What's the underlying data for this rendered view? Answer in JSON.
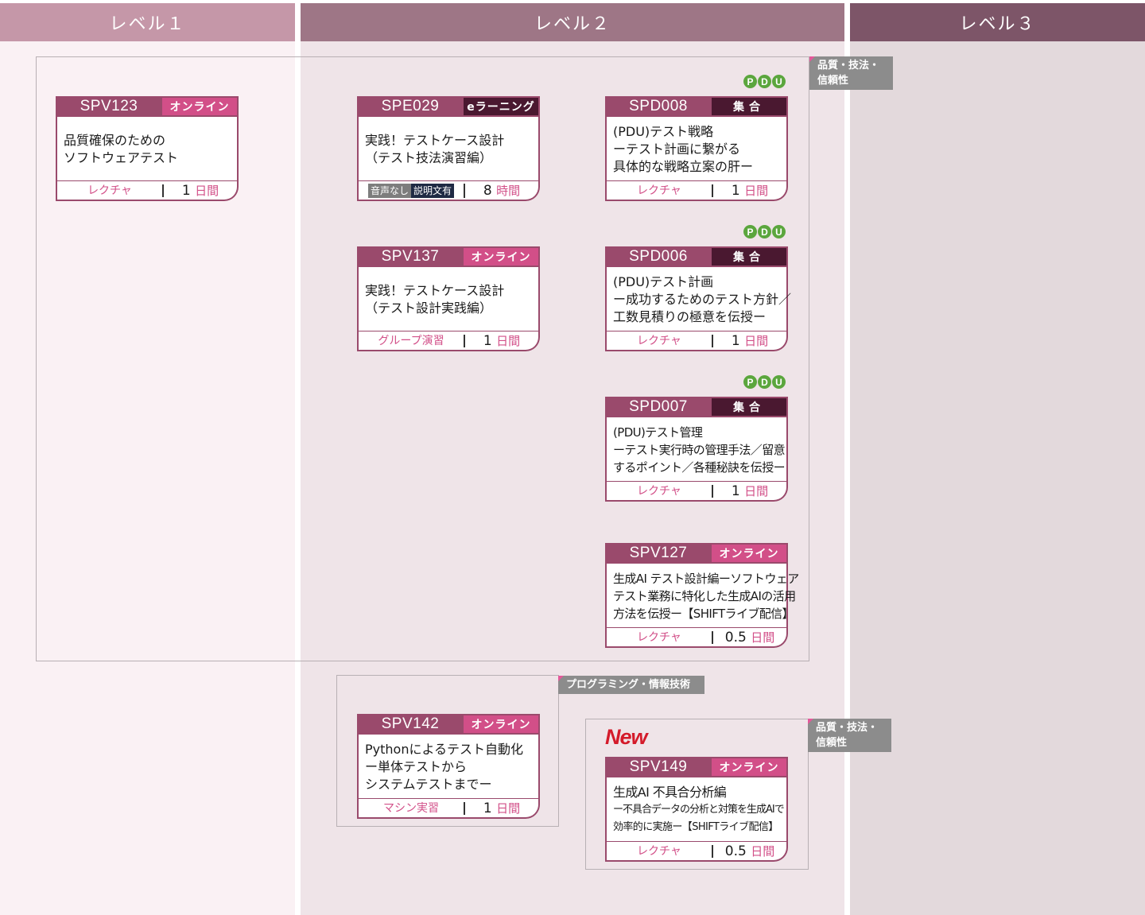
{
  "colors": {
    "level1_header": "#c597a8",
    "level2_header": "#9e7686",
    "level3_header": "#7d5568",
    "level1_bg": "#faf1f4",
    "level2_bg": "#efe4e8",
    "level3_bg": "#e3d9dc",
    "card_accent": "#9a4a6c",
    "online_badge": "#d24f88",
    "shugo_badge": "#4a1830",
    "pdu_green": "#5ba63d",
    "new_red": "#d41a2a",
    "group_tag": "#8c8c8c"
  },
  "levels": [
    {
      "label": "レベル１"
    },
    {
      "label": "レベル２"
    },
    {
      "label": "レベル３"
    }
  ],
  "groups": {
    "quality1": {
      "tag_line1": "品質・技法・",
      "tag_line2": "信頼性"
    },
    "programming": {
      "tag": "プログラミング・情報技術"
    },
    "quality2": {
      "tag_line1": "品質・技法・",
      "tag_line2": "信頼性"
    }
  },
  "pdu_icon": {
    "p": "P",
    "d": "D",
    "u": "U",
    "icon": "pdu-badge-icon"
  },
  "new_mark": "New",
  "courses": {
    "spv123": {
      "code": "SPV123",
      "badge": "オンライン",
      "line1": "品質確保のための",
      "line2": "ソフトウェアテスト",
      "type": "レクチャ",
      "num": "1",
      "unit": "日間"
    },
    "spe029": {
      "code": "SPE029",
      "badge": "eラーニング",
      "line1": "実践！テストケース設計",
      "line2": "（テスト技法演習編）",
      "tag1": "音声なし",
      "tag2": "説明文有",
      "num": "8",
      "unit": "時間"
    },
    "spv137": {
      "code": "SPV137",
      "badge": "オンライン",
      "line1": "実践！テストケース設計",
      "line2": "（テスト設計実践編）",
      "type": "グループ演習",
      "num": "1",
      "unit": "日間"
    },
    "spd008": {
      "code": "SPD008",
      "badge": "集合",
      "line1": "(PDU)テスト戦略",
      "line2": "ーテスト計画に繋がる",
      "line3": "具体的な戦略立案の肝ー",
      "type": "レクチャ",
      "num": "1",
      "unit": "日間"
    },
    "spd006": {
      "code": "SPD006",
      "badge": "集合",
      "line1": "(PDU)テスト計画",
      "line2": "ー成功するためのテスト方針／",
      "line3": "工数見積りの極意を伝授ー",
      "type": "レクチャ",
      "num": "1",
      "unit": "日間"
    },
    "spd007": {
      "code": "SPD007",
      "badge": "集合",
      "line1": "(PDU)テスト管理",
      "line2": "ーテスト実行時の管理手法／留意",
      "line3": "するポイント／各種秘訣を伝授ー",
      "type": "レクチャ",
      "num": "1",
      "unit": "日間"
    },
    "spv127": {
      "code": "SPV127",
      "badge": "オンライン",
      "line1": "生成AI テスト設計編ーソフトウェア",
      "line2": "テスト業務に特化した生成AIの活用",
      "line3": "方法を伝授ー【SHIFTライブ配信】",
      "type": "レクチャ",
      "num": "0.5",
      "unit": "日間"
    },
    "spv142": {
      "code": "SPV142",
      "badge": "オンライン",
      "line1": "Pythonによるテスト自動化",
      "line2": "ー単体テストから",
      "line3": "システムテストまでー",
      "type": "マシン実習",
      "num": "1",
      "unit": "日間"
    },
    "spv149": {
      "code": "SPV149",
      "badge": "オンライン",
      "line1": "生成AI 不具合分析編",
      "line2": "ー不具合データの分析と対策を生成AIで",
      "line3": "効率的に実施ー【SHIFTライブ配信】",
      "type": "レクチャ",
      "num": "0.5",
      "unit": "日間"
    }
  }
}
